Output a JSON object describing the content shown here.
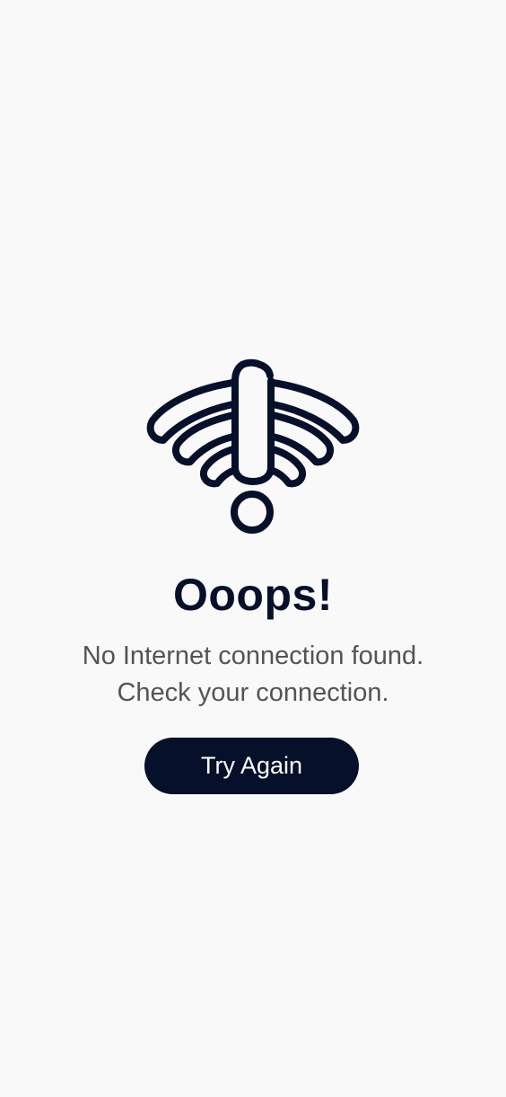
{
  "screen": {
    "illustration_icon": "no-wifi-warning-icon",
    "title": "Ooops!",
    "message_line1": "No Internet connection found.",
    "message_line2": "Check your connection.",
    "retry_button_label": "Try Again"
  },
  "colors": {
    "background": "#f9f9f9",
    "primary": "#06102a",
    "text_muted": "#545454",
    "button_text": "#ffffff"
  }
}
